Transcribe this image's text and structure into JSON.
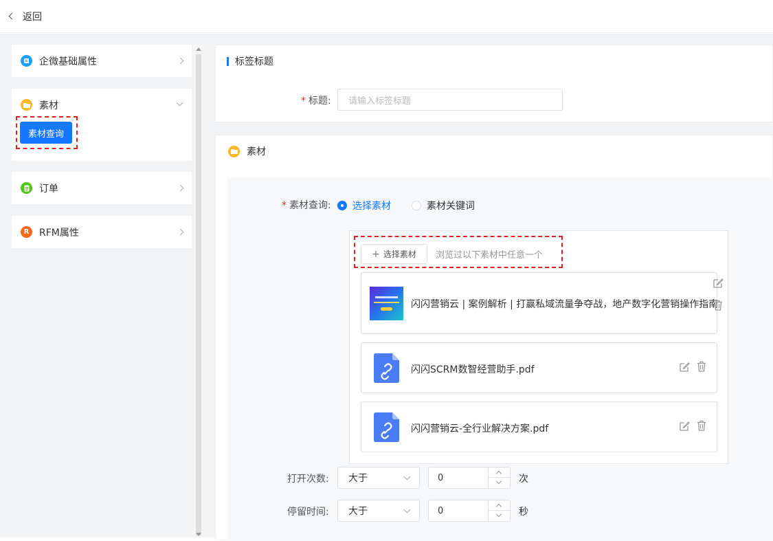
{
  "header": {
    "back_label": "返回"
  },
  "sidebar": {
    "items": [
      {
        "label": "企微基础属性",
        "icon": "building-icon",
        "color": "#1e9fff"
      },
      {
        "label": "素材",
        "icon": "folder-icon",
        "color": "#fbb829",
        "expanded": true,
        "sub_button": "素材查询"
      },
      {
        "label": "订单",
        "icon": "document-icon",
        "color": "#52c41a"
      },
      {
        "label": "RFM属性",
        "icon": "letter-r-icon",
        "glyph": "R",
        "color": "#fa6a1e"
      }
    ]
  },
  "title_section": {
    "heading": "标签标题",
    "field_label": "标题:",
    "field_placeholder": "请输入标签标题"
  },
  "material_section": {
    "heading": "素材",
    "query_label": "素材查询:",
    "radio_options": [
      {
        "label": "选择素材",
        "selected": true
      },
      {
        "label": "素材关键词",
        "selected": false
      }
    ],
    "select_button": "选择素材",
    "select_hint": "浏览过以下素材中任意一个",
    "materials": [
      {
        "title": "闪闪营销云 | 案例解析 | 打赢私域流量争夺战，地产数字化营销操作指南",
        "type": "article"
      },
      {
        "title": "闪闪SCRM数智经营助手.pdf",
        "type": "pdf"
      },
      {
        "title": "闪闪营销云-全行业解决方案.pdf",
        "type": "pdf"
      }
    ],
    "open_count": {
      "label": "打开次数:",
      "operator": "大于",
      "value": "0",
      "unit": "次"
    },
    "stay_time": {
      "label": "停留时间:",
      "operator": "大于",
      "value": "0",
      "unit": "秒"
    }
  },
  "colors": {
    "primary": "#1677ff",
    "highlight_dash": "#e02020"
  }
}
